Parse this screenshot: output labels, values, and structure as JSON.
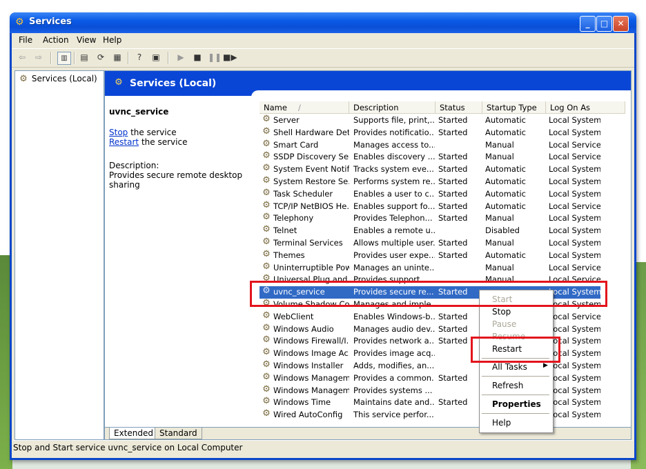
{
  "window": {
    "title": "Services"
  },
  "menubar": [
    "File",
    "Action",
    "View",
    "Help"
  ],
  "tree": {
    "root_label": "Services (Local)"
  },
  "pane": {
    "header_title": "Services (Local)"
  },
  "description": {
    "service_name": "uvnc_service",
    "stop_link": "Stop",
    "stop_suffix": " the service",
    "restart_link": "Restart",
    "restart_suffix": " the service",
    "label": "Description:",
    "text": "Provides secure remote desktop sharing"
  },
  "columns": [
    "Name",
    "Description",
    "Status",
    "Startup Type",
    "Log On As"
  ],
  "rows": [
    {
      "name": "Server",
      "desc": "Supports file, print,...",
      "status": "Started",
      "startup": "Automatic",
      "logon": "Local System"
    },
    {
      "name": "Shell Hardware Det...",
      "desc": "Provides notificatio...",
      "status": "Started",
      "startup": "Automatic",
      "logon": "Local System"
    },
    {
      "name": "Smart Card",
      "desc": "Manages access to...",
      "status": "",
      "startup": "Manual",
      "logon": "Local Service"
    },
    {
      "name": "SSDP Discovery Ser...",
      "desc": "Enables discovery ...",
      "status": "Started",
      "startup": "Manual",
      "logon": "Local Service"
    },
    {
      "name": "System Event Notifi...",
      "desc": "Tracks system eve...",
      "status": "Started",
      "startup": "Automatic",
      "logon": "Local System"
    },
    {
      "name": "System Restore Se...",
      "desc": "Performs system re...",
      "status": "Started",
      "startup": "Automatic",
      "logon": "Local System"
    },
    {
      "name": "Task Scheduler",
      "desc": "Enables a user to c...",
      "status": "Started",
      "startup": "Automatic",
      "logon": "Local System"
    },
    {
      "name": "TCP/IP NetBIOS He...",
      "desc": "Enables support fo...",
      "status": "Started",
      "startup": "Automatic",
      "logon": "Local Service"
    },
    {
      "name": "Telephony",
      "desc": "Provides Telephon...",
      "status": "Started",
      "startup": "Manual",
      "logon": "Local System"
    },
    {
      "name": "Telnet",
      "desc": "Enables a remote u...",
      "status": "",
      "startup": "Disabled",
      "logon": "Local System"
    },
    {
      "name": "Terminal Services",
      "desc": "Allows multiple user...",
      "status": "Started",
      "startup": "Manual",
      "logon": "Local System"
    },
    {
      "name": "Themes",
      "desc": "Provides user expe...",
      "status": "Started",
      "startup": "Automatic",
      "logon": "Local System"
    },
    {
      "name": "Uninterruptible Pow...",
      "desc": "Manages an uninte...",
      "status": "",
      "startup": "Manual",
      "logon": "Local Service"
    },
    {
      "name": "Universal Plug and ...",
      "desc": "Provides support ...",
      "status": "",
      "startup": "Manual",
      "logon": "Local Service"
    },
    {
      "name": "uvnc_service",
      "desc": "Provides secure re...",
      "status": "Started",
      "startup": "",
      "logon": "Local System"
    },
    {
      "name": "Volume Shadow Copy",
      "desc": "Manages and imple...",
      "status": "",
      "startup": "",
      "logon": "Local System"
    },
    {
      "name": "WebClient",
      "desc": "Enables Windows-b...",
      "status": "Started",
      "startup": "",
      "logon": "Local Service"
    },
    {
      "name": "Windows Audio",
      "desc": "Manages audio dev...",
      "status": "Started",
      "startup": "",
      "logon": "Local System"
    },
    {
      "name": "Windows Firewall/I...",
      "desc": "Provides network a...",
      "status": "Started",
      "startup": "",
      "logon": "Local System"
    },
    {
      "name": "Windows Image Ac...",
      "desc": "Provides image acq...",
      "status": "",
      "startup": "",
      "logon": "Local System"
    },
    {
      "name": "Windows Installer",
      "desc": "Adds, modifies, an...",
      "status": "",
      "startup": "",
      "logon": "Local System"
    },
    {
      "name": "Windows Managem...",
      "desc": "Provides a common...",
      "status": "Started",
      "startup": "",
      "logon": "Local System"
    },
    {
      "name": "Windows Managem...",
      "desc": "Provides systems ...",
      "status": "",
      "startup": "",
      "logon": "Local System"
    },
    {
      "name": "Windows Time",
      "desc": "Maintains date and...",
      "status": "Started",
      "startup": "",
      "logon": "Local System"
    },
    {
      "name": "Wired AutoConfig",
      "desc": "This service perfor...",
      "status": "",
      "startup": "",
      "logon": "Local System"
    }
  ],
  "context_menu": {
    "start": "Start",
    "stop": "Stop",
    "pause": "Pause",
    "resume": "Resume",
    "restart": "Restart",
    "all_tasks": "All Tasks",
    "refresh": "Refresh",
    "properties": "Properties",
    "help": "Help"
  },
  "tabs": [
    "Extended",
    "Standard"
  ],
  "status_bar": "Stop and Start service uvnc_service on Local Computer",
  "colors": {
    "titlebar": "#0a5ae6",
    "selection": "#316ac5",
    "highlight": "#e3141c"
  }
}
